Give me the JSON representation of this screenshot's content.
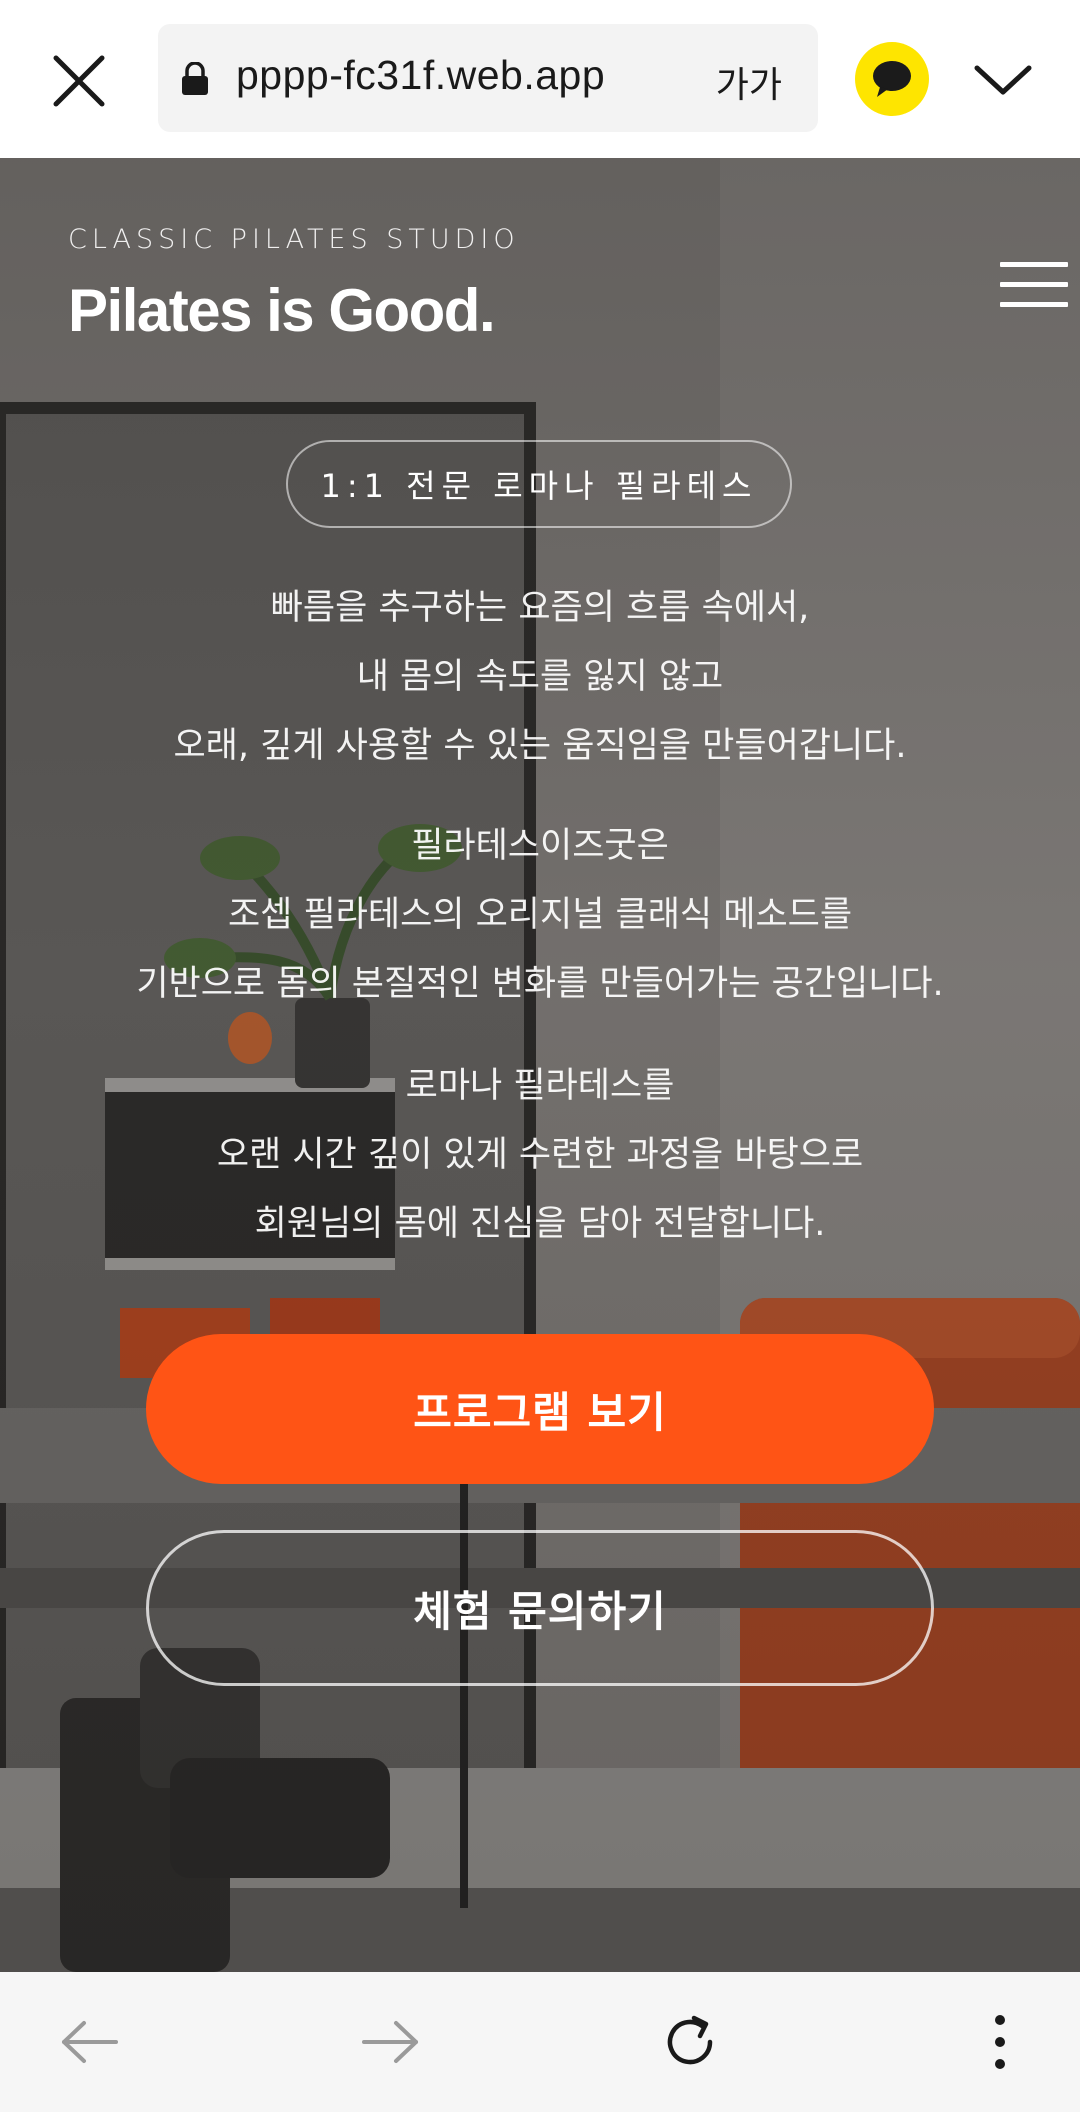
{
  "browser": {
    "url": "pppp-fc31f.web.app",
    "text_size_label": "가가",
    "icons": {
      "close": "close-icon",
      "lock": "lock-icon",
      "kakao": "kakaotalk-icon",
      "expand": "chevron-down-icon",
      "back": "arrow-left-icon",
      "forward": "arrow-right-icon",
      "refresh": "refresh-icon",
      "more": "more-vertical-icon"
    }
  },
  "hero": {
    "kicker": "CLASSIC PILATES STUDIO",
    "brand": "Pilates is Good.",
    "menu_icon": "hamburger-menu-icon",
    "badge": "1:1 전문 로마나 필라테스",
    "paragraphs": [
      [
        "빠름을 추구하는 요즘의 흐름 속에서,",
        "내 몸의 속도를 잃지 않고",
        "오래, 깊게 사용할 수 있는 움직임을 만들어갑니다."
      ],
      [
        "필라테스이즈굿은",
        "조셉 필라테스의 오리지널 클래식 메소드를",
        "기반으로 몸의 본질적인 변화를 만들어가는 공간입니다."
      ],
      [
        "로마나 필라테스를",
        "오랜 시간 깊이 있게 수련한 과정을 바탕으로",
        "회원님의 몸에 진심을 담아 전달합니다."
      ]
    ],
    "primary_button": "프로그램 보기",
    "secondary_button": "체험 문의하기"
  },
  "colors": {
    "accent": "#ff5415",
    "kakao_yellow": "#fee500",
    "bottom_bar": "#f6f6f6"
  }
}
